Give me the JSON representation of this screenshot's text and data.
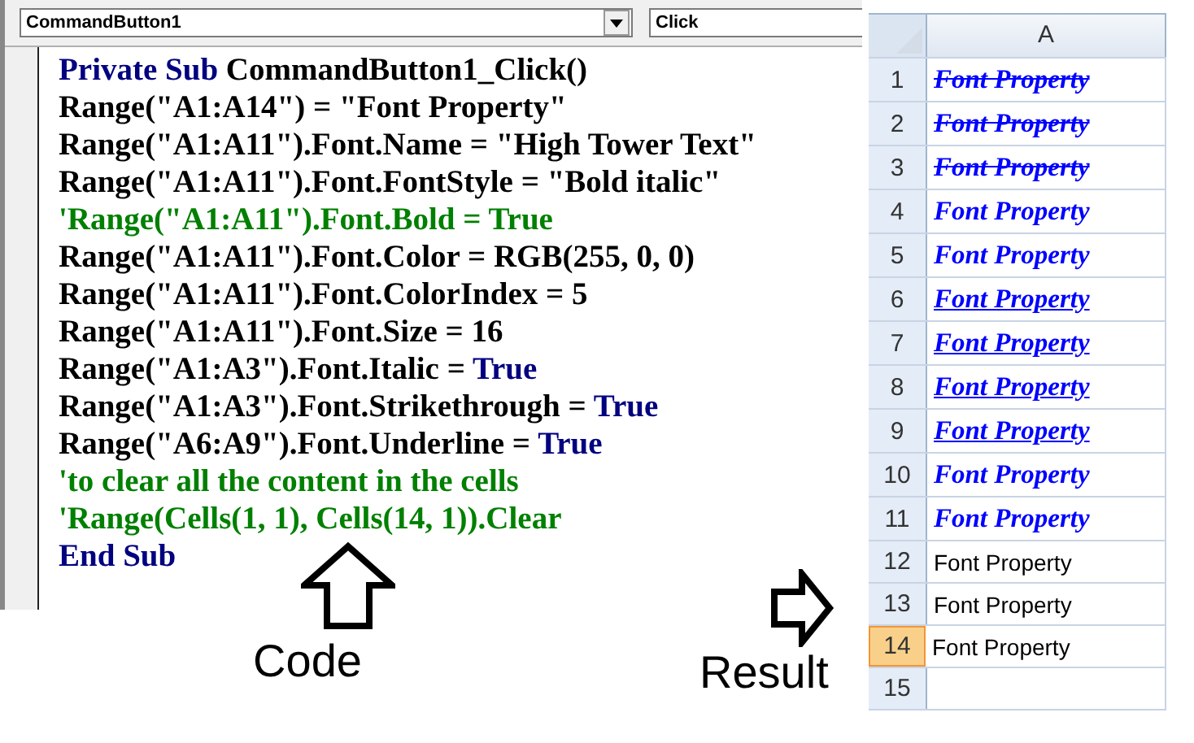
{
  "editor": {
    "object_dropdown": {
      "value": "CommandButton1"
    },
    "procedure_dropdown": {
      "value": "Click"
    },
    "code_lines": [
      {
        "segments": [
          {
            "text": "Private Sub",
            "kind": "keyword"
          },
          {
            "text": " CommandButton1_Click()",
            "kind": "plain"
          }
        ]
      },
      {
        "segments": [
          {
            "text": "Range(\"A1:A14\") = \"Font Property\"",
            "kind": "plain"
          }
        ]
      },
      {
        "segments": [
          {
            "text": "Range(\"A1:A11\").Font.Name = \"High Tower Text\"",
            "kind": "plain"
          }
        ]
      },
      {
        "segments": [
          {
            "text": "Range(\"A1:A11\").Font.FontStyle = \"Bold italic\"",
            "kind": "plain"
          }
        ]
      },
      {
        "segments": [
          {
            "text": "'Range(\"A1:A11\").Font.Bold = True",
            "kind": "comment"
          }
        ]
      },
      {
        "segments": [
          {
            "text": "Range(\"A1:A11\").Font.Color = RGB(255, 0, 0)",
            "kind": "plain"
          }
        ]
      },
      {
        "segments": [
          {
            "text": "Range(\"A1:A11\").Font.ColorIndex = 5",
            "kind": "plain"
          }
        ]
      },
      {
        "segments": [
          {
            "text": "Range(\"A1:A11\").Font.Size = 16",
            "kind": "plain"
          }
        ]
      },
      {
        "segments": [
          {
            "text": "Range(\"A1:A3\").Font.Italic = ",
            "kind": "plain"
          },
          {
            "text": "True",
            "kind": "keyword"
          }
        ]
      },
      {
        "segments": [
          {
            "text": "Range(\"A1:A3\").Font.Strikethrough = ",
            "kind": "plain"
          },
          {
            "text": "True",
            "kind": "keyword"
          }
        ]
      },
      {
        "segments": [
          {
            "text": "Range(\"A6:A9\").Font.Underline = ",
            "kind": "plain"
          },
          {
            "text": "True",
            "kind": "keyword"
          }
        ]
      },
      {
        "segments": [
          {
            "text": "'to clear all the content in the cells",
            "kind": "comment"
          }
        ]
      },
      {
        "segments": [
          {
            "text": "'Range(Cells(1, 1), Cells(14, 1)).Clear",
            "kind": "comment"
          }
        ]
      },
      {
        "segments": [
          {
            "text": "End Sub",
            "kind": "keyword"
          }
        ]
      }
    ]
  },
  "spreadsheet": {
    "column_header": "A",
    "rows": [
      {
        "number": "1",
        "selected": false,
        "cell": {
          "text": "Font Property",
          "kind": "formatted",
          "color": "#0000ff",
          "strikethrough": true,
          "underline": false
        }
      },
      {
        "number": "2",
        "selected": false,
        "cell": {
          "text": "Font Property",
          "kind": "formatted",
          "color": "#0000ff",
          "strikethrough": true,
          "underline": false
        }
      },
      {
        "number": "3",
        "selected": false,
        "cell": {
          "text": "Font Property",
          "kind": "formatted",
          "color": "#0000ff",
          "strikethrough": true,
          "underline": false
        }
      },
      {
        "number": "4",
        "selected": false,
        "cell": {
          "text": "Font Property",
          "kind": "formatted",
          "color": "#0000ff",
          "strikethrough": false,
          "underline": false
        }
      },
      {
        "number": "5",
        "selected": false,
        "cell": {
          "text": "Font Property",
          "kind": "formatted",
          "color": "#0000ff",
          "strikethrough": false,
          "underline": false
        }
      },
      {
        "number": "6",
        "selected": false,
        "cell": {
          "text": "Font Property",
          "kind": "formatted",
          "color": "#0000ff",
          "strikethrough": false,
          "underline": true
        }
      },
      {
        "number": "7",
        "selected": false,
        "cell": {
          "text": "Font Property",
          "kind": "formatted",
          "color": "#0000ff",
          "strikethrough": false,
          "underline": true
        }
      },
      {
        "number": "8",
        "selected": false,
        "cell": {
          "text": "Font Property",
          "kind": "formatted",
          "color": "#0000ff",
          "strikethrough": false,
          "underline": true
        }
      },
      {
        "number": "9",
        "selected": false,
        "cell": {
          "text": "Font Property",
          "kind": "formatted",
          "color": "#0000ff",
          "strikethrough": false,
          "underline": true
        }
      },
      {
        "number": "10",
        "selected": false,
        "cell": {
          "text": "Font Property",
          "kind": "formatted",
          "color": "#0000ff",
          "strikethrough": false,
          "underline": false
        }
      },
      {
        "number": "11",
        "selected": false,
        "cell": {
          "text": "Font Property",
          "kind": "formatted",
          "color": "#0000ff",
          "strikethrough": false,
          "underline": false
        }
      },
      {
        "number": "12",
        "selected": false,
        "cell": {
          "text": "Font Property",
          "kind": "default",
          "color": "#000000",
          "strikethrough": false,
          "underline": false
        }
      },
      {
        "number": "13",
        "selected": false,
        "cell": {
          "text": "Font Property",
          "kind": "default",
          "color": "#000000",
          "strikethrough": false,
          "underline": false
        }
      },
      {
        "number": "14",
        "selected": true,
        "cell": {
          "text": "Font Property",
          "kind": "default",
          "color": "#000000",
          "strikethrough": false,
          "underline": false
        }
      },
      {
        "number": "15",
        "selected": false
      }
    ]
  },
  "annotations": [
    {
      "label": "Code",
      "kind": "up"
    },
    {
      "label": "Result",
      "kind": "right"
    }
  ]
}
